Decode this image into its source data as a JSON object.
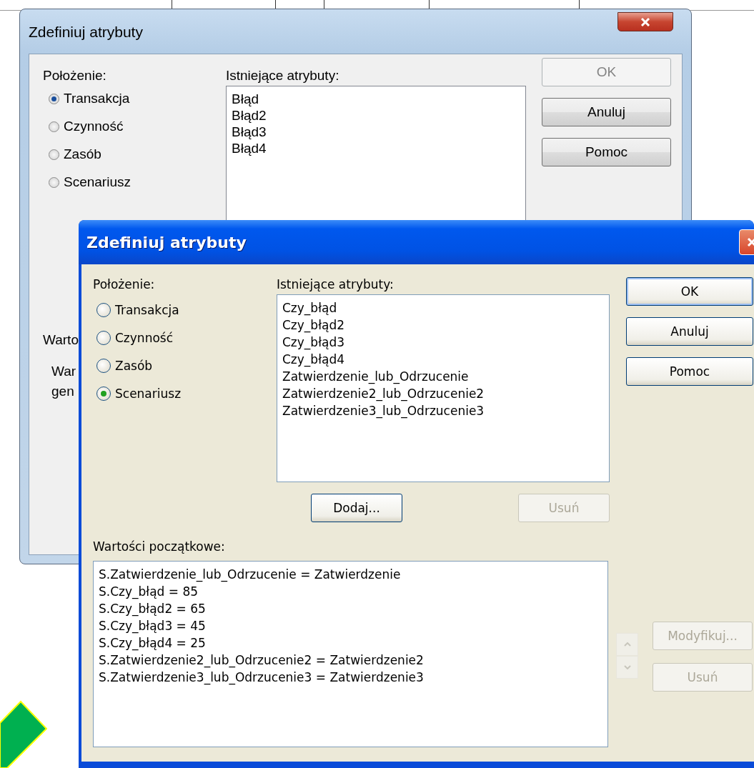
{
  "background_window": {
    "title": "Zdefiniuj atrybuty",
    "location_label": "Położenie:",
    "locations": [
      {
        "label": "Transakcja",
        "selected": true
      },
      {
        "label": "Czynność",
        "selected": false
      },
      {
        "label": "Zasób",
        "selected": false
      },
      {
        "label": "Scenariusz",
        "selected": false
      }
    ],
    "attributes_label": "Istniejące atrybuty:",
    "attributes": [
      "Błąd",
      "Błąd2",
      "Błąd3",
      "Błąd4"
    ],
    "buttons": [
      {
        "label": "OK",
        "disabled": true
      },
      {
        "label": "Anuluj",
        "disabled": false
      },
      {
        "label": "Pomoc",
        "disabled": false
      }
    ],
    "values_label": "Warto",
    "values_hint": [
      "War",
      "gen"
    ]
  },
  "front_window": {
    "title": "Zdefiniuj atrybuty",
    "location_label": "Położenie:",
    "locations": [
      {
        "label": "Transakcja",
        "selected": false
      },
      {
        "label": "Czynność",
        "selected": false
      },
      {
        "label": "Zasób",
        "selected": false
      },
      {
        "label": "Scenariusz",
        "selected": true
      }
    ],
    "attributes_label": "Istniejące atrybuty:",
    "attributes": [
      "Czy_błąd",
      "Czy_błąd2",
      "Czy_błąd3",
      "Czy_błąd4",
      "Zatwierdzenie_lub_Odrzucenie",
      "Zatwierdzenie2_lub_Odrzucenie2",
      "Zatwierdzenie3_lub_Odrzucenie3"
    ],
    "attribute_buttons": [
      {
        "label": "Dodaj...",
        "disabled": false
      },
      {
        "label": "Usuń",
        "disabled": true
      }
    ],
    "buttons": [
      {
        "label": "OK",
        "default": true
      },
      {
        "label": "Anuluj",
        "default": false
      },
      {
        "label": "Pomoc",
        "default": false
      }
    ],
    "initial_values_label": "Wartości początkowe:",
    "initial_values": [
      "S.Zatwierdzenie_lub_Odrzucenie = Zatwierdzenie",
      "S.Czy_błąd = 85",
      "S.Czy_błąd2 = 65",
      "S.Czy_błąd3 = 45",
      "S.Czy_błąd4 = 25",
      "S.Zatwierdzenie2_lub_Odrzucenie2 = Zatwierdzenie2",
      "S.Zatwierdzenie3_lub_Odrzucenie3 = Zatwierdzenie3"
    ],
    "order_disabled": true,
    "value_buttons": [
      {
        "label": "Modyfikuj...",
        "disabled": true
      },
      {
        "label": "Usuń",
        "disabled": true
      }
    ]
  }
}
